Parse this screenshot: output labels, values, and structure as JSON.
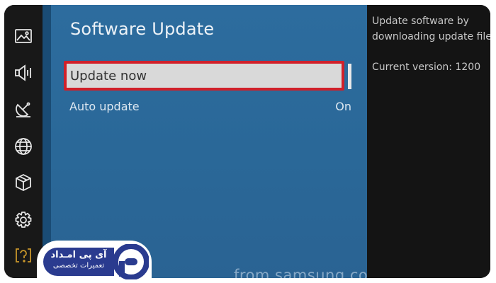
{
  "sidebar": {
    "icons": [
      {
        "name": "picture-icon"
      },
      {
        "name": "sound-icon"
      },
      {
        "name": "broadcast-icon"
      },
      {
        "name": "network-icon"
      },
      {
        "name": "smart-hub-icon"
      },
      {
        "name": "settings-icon"
      },
      {
        "name": "support-icon"
      }
    ]
  },
  "panel": {
    "title": "Software Update",
    "items": [
      {
        "label": "Update now",
        "value": "",
        "selected": true
      },
      {
        "label": "Auto update",
        "value": "On",
        "selected": false
      }
    ],
    "watermark": "from samsung.com"
  },
  "info": {
    "description": "Update software by\ndownloading update files",
    "version": "Current version: 1200"
  },
  "logo": {
    "line1": "آی پی امـداد",
    "line2": "تعمیرات تخصصی"
  },
  "colors": {
    "panel_blue": "#2d6c9e",
    "selection_border": "#d0202a",
    "selection_fill": "#d9d9d9",
    "support_icon": "#c8962a",
    "logo_blue": "#2a3b8f"
  }
}
